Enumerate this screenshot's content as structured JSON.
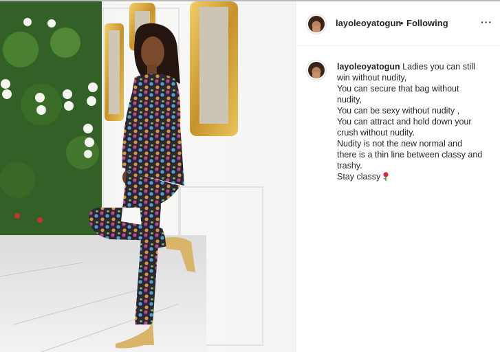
{
  "post": {
    "username": "layoleoyatogun",
    "separator": "•",
    "follow_state": "Following",
    "more_icon": "more-options-icon"
  },
  "caption": {
    "username": "layoleoyatogun",
    "lines": [
      "Ladies you can still",
      "win without nudity,",
      "You can secure that bag without",
      "nudity,",
      "You can be sexy without nudity ,",
      "You can attract and hold down your",
      "crush without nudity.",
      "Nudity is not the new normal and",
      "there is a thin line between classy and",
      "trashy.",
      "Stay classy"
    ],
    "emoji_icon": "rose-icon"
  },
  "colors": {
    "text": "#262626",
    "divider": "#efefef",
    "wall": "#f6f6f5",
    "gold_frame": "#d8a93a",
    "greenery": "#2f5a24"
  }
}
